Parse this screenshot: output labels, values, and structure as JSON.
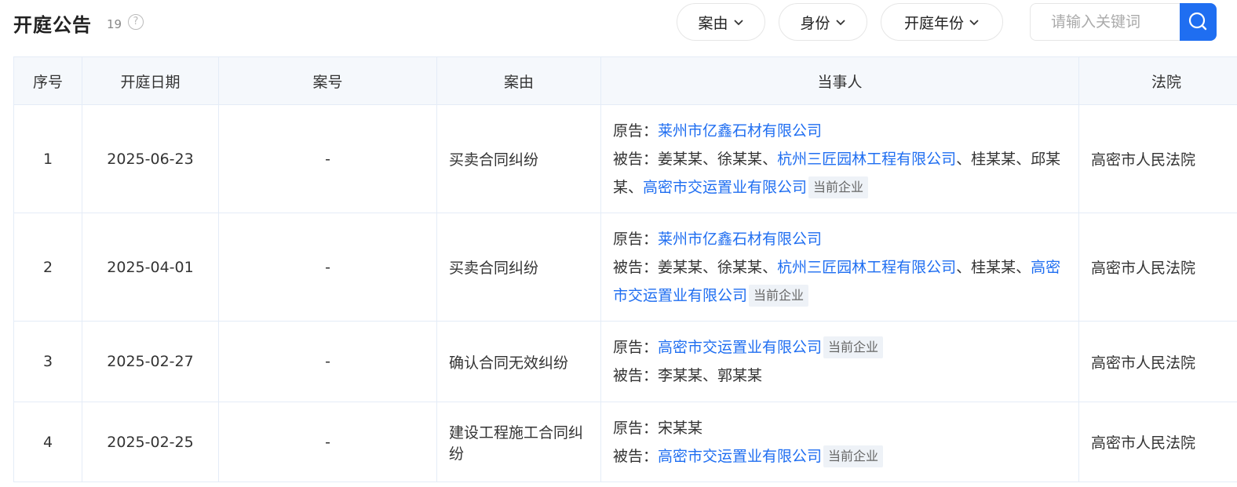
{
  "header": {
    "title": "开庭公告",
    "count": "19",
    "help": "?"
  },
  "filters": [
    {
      "label": "案由"
    },
    {
      "label": "身份"
    },
    {
      "label": "开庭年份"
    }
  ],
  "search": {
    "placeholder": "请输入关键词"
  },
  "table": {
    "columns": [
      "序号",
      "开庭日期",
      "案号",
      "案由",
      "当事人",
      "法院"
    ],
    "rows": [
      {
        "index": "1",
        "date": "2025-06-23",
        "case_no": "-",
        "reason": "买卖合同纠纷",
        "court": "高密市人民法院",
        "plaintiff_label": "原告：",
        "plaintiff": [
          {
            "text": "莱州市亿鑫石材有限公司",
            "link": true
          }
        ],
        "defendant_label": "被告：",
        "defendant": [
          {
            "text": "姜某某",
            "link": false
          },
          {
            "text": "、",
            "link": false
          },
          {
            "text": "徐某某",
            "link": false
          },
          {
            "text": "、",
            "link": false
          },
          {
            "text": "杭州三匠园林工程有限公司",
            "link": true
          },
          {
            "text": "、",
            "link": false
          },
          {
            "text": "桂某某",
            "link": false
          },
          {
            "text": "、",
            "link": false
          },
          {
            "text": "邱某某",
            "link": false
          },
          {
            "text": "、",
            "link": false
          },
          {
            "text": "高密市交运置业有限公司",
            "link": true,
            "tag": "当前企业"
          }
        ]
      },
      {
        "index": "2",
        "date": "2025-04-01",
        "case_no": "-",
        "reason": "买卖合同纠纷",
        "court": "高密市人民法院",
        "plaintiff_label": "原告：",
        "plaintiff": [
          {
            "text": "莱州市亿鑫石材有限公司",
            "link": true
          }
        ],
        "defendant_label": "被告：",
        "defendant": [
          {
            "text": "姜某某",
            "link": false
          },
          {
            "text": "、",
            "link": false
          },
          {
            "text": "徐某某",
            "link": false
          },
          {
            "text": "、",
            "link": false
          },
          {
            "text": "杭州三匠园林工程有限公司",
            "link": true
          },
          {
            "text": "、",
            "link": false
          },
          {
            "text": "桂某某",
            "link": false
          },
          {
            "text": "、",
            "link": false
          },
          {
            "text": "高密市交运置业有限公司",
            "link": true,
            "tag": "当前企业"
          }
        ]
      },
      {
        "index": "3",
        "date": "2025-02-27",
        "case_no": "-",
        "reason": "确认合同无效纠纷",
        "court": "高密市人民法院",
        "plaintiff_label": "原告：",
        "plaintiff": [
          {
            "text": "高密市交运置业有限公司",
            "link": true,
            "tag": "当前企业"
          }
        ],
        "defendant_label": "被告：",
        "defendant": [
          {
            "text": "李某某",
            "link": false
          },
          {
            "text": "、",
            "link": false
          },
          {
            "text": "郭某某",
            "link": false
          }
        ]
      },
      {
        "index": "4",
        "date": "2025-02-25",
        "case_no": "-",
        "reason": "建设工程施工合同纠纷",
        "court": "高密市人民法院",
        "plaintiff_label": "原告：",
        "plaintiff": [
          {
            "text": "宋某某",
            "link": false
          }
        ],
        "defendant_label": "被告：",
        "defendant": [
          {
            "text": "高密市交运置业有限公司",
            "link": true,
            "tag": "当前企业"
          }
        ]
      }
    ]
  }
}
